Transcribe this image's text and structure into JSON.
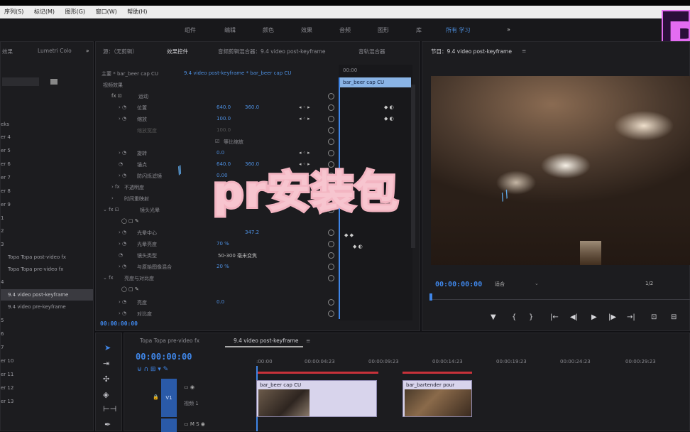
{
  "menubar": {
    "items": [
      "序列(S)",
      "标记(M)",
      "图形(G)",
      "窗口(W)",
      "帮助(H)"
    ]
  },
  "workspace": {
    "tabs": [
      "组件",
      "编辑",
      "颜色",
      "效果",
      "音频",
      "图形",
      "库",
      "所有 学习"
    ],
    "more": "»"
  },
  "left_panel": {
    "tab1": "效果",
    "tab2": "Lumetri Colo",
    "more": "»",
    "items": [
      "eks",
      "er 4",
      "er 5",
      "er 6",
      "er 7",
      "er 8",
      "er 9",
      "1",
      "2",
      "3",
      "Topa Topa post-video fx",
      "Topa Topa pre-video fx",
      "4",
      "9.4 video post-keyframe",
      "9.4 video pre-keyframe",
      "5",
      "6",
      "7",
      "er 10",
      "er 11",
      "er 12",
      "er 13"
    ]
  },
  "effect_controls": {
    "tab_source": "源：（无剪辑）",
    "tab_ec": "效果控件",
    "tab_mixer": "音频剪辑混合器：9.4 video post-keyframe",
    "tab_meta": "音轨混合器",
    "master_label": "主要 * bar_beer cap CU",
    "sequence_label": "9.4 video post-keyframe * bar_beer cap CU",
    "video_effects": "视频效果",
    "rows": [
      {
        "name": "运动",
        "value": "",
        "value2": ""
      },
      {
        "name": "位置",
        "value": "640.0",
        "value2": "360.0"
      },
      {
        "name": "缩放",
        "value": "100.0",
        "value2": ""
      },
      {
        "name": "缩放宽度",
        "value": "100.0",
        "value2": ""
      },
      {
        "name": "等比缩放",
        "value": "",
        "value2": ""
      },
      {
        "name": "旋转",
        "value": "0.0",
        "value2": ""
      },
      {
        "name": "锚点",
        "value": "640.0",
        "value2": "360.0"
      },
      {
        "name": "防闪烁滤镜",
        "value": "0.00",
        "value2": ""
      },
      {
        "name": "不透明度",
        "value": "",
        "value2": ""
      },
      {
        "name": "时间重映射",
        "value": "",
        "value2": ""
      },
      {
        "name": "镜头光晕",
        "value": "",
        "value2": ""
      },
      {
        "name": "",
        "value": "",
        "value2": ""
      },
      {
        "name": "光晕中心",
        "value": "",
        "value2": "347.2"
      },
      {
        "name": "光晕亮度",
        "value": "70 %",
        "value2": ""
      },
      {
        "name": "镜头类型",
        "value": "50-300 毫米变焦",
        "value2": ""
      },
      {
        "name": "与原始图像混合",
        "value": "20 %",
        "value2": ""
      },
      {
        "name": "亮度与对比度",
        "value": "",
        "value2": ""
      },
      {
        "name": "",
        "value": "",
        "value2": ""
      },
      {
        "name": "亮度",
        "value": "0.0",
        "value2": ""
      },
      {
        "name": "对比度",
        "value": "",
        "value2": ""
      }
    ],
    "clip_header": "00:00",
    "clip_name": "bar_beer cap CU",
    "timecode": "00:00:00:00"
  },
  "program": {
    "title": "节目：9.4 video post-keyframe",
    "menu": "≡",
    "timecode": "00:00:00:00",
    "fit": "适合",
    "resolution": "1/2",
    "controls": [
      "▼",
      "{",
      "}",
      "|←",
      "◀|",
      "▶",
      "|▶",
      "→|",
      "⊡",
      "⊟"
    ]
  },
  "timeline": {
    "tab1": "Topa Topa pre-video fx",
    "tab2": "9.4 video post-keyframe",
    "menu": "≡",
    "timecode": "00:00:00:00",
    "ruler": [
      ":00:00",
      "00:00:04:23",
      "00:00:09:23",
      "00:00:14:23",
      "00:00:19:23",
      "00:00:24:23",
      "00:00:29:23"
    ],
    "track_v1": "V1",
    "track_label": "视频 1",
    "clip1": "bar_beer cap CU",
    "clip2": "bar_bartender pour"
  },
  "overlay_text": "pr安装包",
  "badge": "P",
  "colors": {
    "accent": "#3f86e8",
    "overlay_pink": "#f7c5cf",
    "badge_bg": "#2a0f3a",
    "badge_fg": "#e36cf1"
  }
}
